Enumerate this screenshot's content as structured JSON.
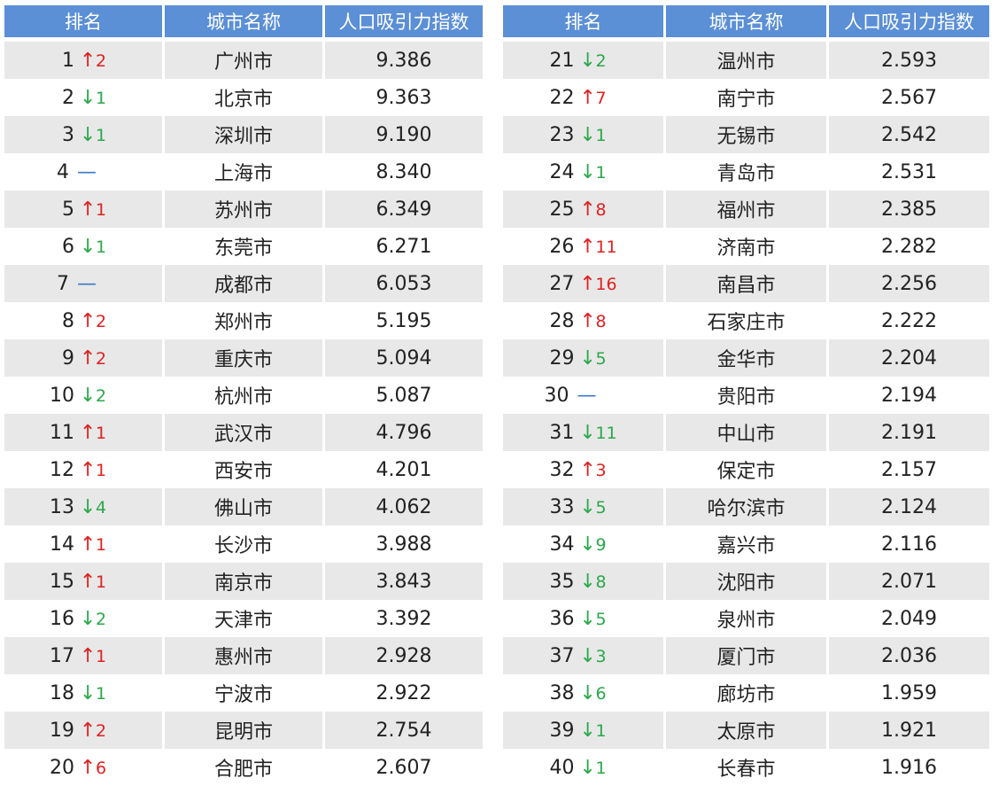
{
  "headers": {
    "rank": "排名",
    "city": "城市名称",
    "index": "人口吸引力指数"
  },
  "colors": {
    "header_bg": "#5b8fd6",
    "up": "#e02020",
    "down": "#2aa84a",
    "flat": "#3a78c9",
    "stripe": "#e8e8e8"
  },
  "rows": [
    {
      "rank": "1",
      "dir": "up",
      "change": "2",
      "city": "广州市",
      "index": "9.386"
    },
    {
      "rank": "2",
      "dir": "down",
      "change": "1",
      "city": "北京市",
      "index": "9.363"
    },
    {
      "rank": "3",
      "dir": "down",
      "change": "1",
      "city": "深圳市",
      "index": "9.190"
    },
    {
      "rank": "4",
      "dir": "flat",
      "change": "",
      "city": "上海市",
      "index": "8.340"
    },
    {
      "rank": "5",
      "dir": "up",
      "change": "1",
      "city": "苏州市",
      "index": "6.349"
    },
    {
      "rank": "6",
      "dir": "down",
      "change": "1",
      "city": "东莞市",
      "index": "6.271"
    },
    {
      "rank": "7",
      "dir": "flat",
      "change": "",
      "city": "成都市",
      "index": "6.053"
    },
    {
      "rank": "8",
      "dir": "up",
      "change": "2",
      "city": "郑州市",
      "index": "5.195"
    },
    {
      "rank": "9",
      "dir": "up",
      "change": "2",
      "city": "重庆市",
      "index": "5.094"
    },
    {
      "rank": "10",
      "dir": "down",
      "change": "2",
      "city": "杭州市",
      "index": "5.087"
    },
    {
      "rank": "11",
      "dir": "up",
      "change": "1",
      "city": "武汉市",
      "index": "4.796"
    },
    {
      "rank": "12",
      "dir": "up",
      "change": "1",
      "city": "西安市",
      "index": "4.201"
    },
    {
      "rank": "13",
      "dir": "down",
      "change": "4",
      "city": "佛山市",
      "index": "4.062"
    },
    {
      "rank": "14",
      "dir": "up",
      "change": "1",
      "city": "长沙市",
      "index": "3.988"
    },
    {
      "rank": "15",
      "dir": "up",
      "change": "1",
      "city": "南京市",
      "index": "3.843"
    },
    {
      "rank": "16",
      "dir": "down",
      "change": "2",
      "city": "天津市",
      "index": "3.392"
    },
    {
      "rank": "17",
      "dir": "up",
      "change": "1",
      "city": "惠州市",
      "index": "2.928"
    },
    {
      "rank": "18",
      "dir": "down",
      "change": "1",
      "city": "宁波市",
      "index": "2.922"
    },
    {
      "rank": "19",
      "dir": "up",
      "change": "2",
      "city": "昆明市",
      "index": "2.754"
    },
    {
      "rank": "20",
      "dir": "up",
      "change": "6",
      "city": "合肥市",
      "index": "2.607"
    },
    {
      "rank": "21",
      "dir": "down",
      "change": "2",
      "city": "温州市",
      "index": "2.593"
    },
    {
      "rank": "22",
      "dir": "up",
      "change": "7",
      "city": "南宁市",
      "index": "2.567"
    },
    {
      "rank": "23",
      "dir": "down",
      "change": "1",
      "city": "无锡市",
      "index": "2.542"
    },
    {
      "rank": "24",
      "dir": "down",
      "change": "1",
      "city": "青岛市",
      "index": "2.531"
    },
    {
      "rank": "25",
      "dir": "up",
      "change": "8",
      "city": "福州市",
      "index": "2.385"
    },
    {
      "rank": "26",
      "dir": "up",
      "change": "11",
      "city": "济南市",
      "index": "2.282"
    },
    {
      "rank": "27",
      "dir": "up",
      "change": "16",
      "city": "南昌市",
      "index": "2.256"
    },
    {
      "rank": "28",
      "dir": "up",
      "change": "8",
      "city": "石家庄市",
      "index": "2.222"
    },
    {
      "rank": "29",
      "dir": "down",
      "change": "5",
      "city": "金华市",
      "index": "2.204"
    },
    {
      "rank": "30",
      "dir": "flat",
      "change": "",
      "city": "贵阳市",
      "index": "2.194"
    },
    {
      "rank": "31",
      "dir": "down",
      "change": "11",
      "city": "中山市",
      "index": "2.191"
    },
    {
      "rank": "32",
      "dir": "up",
      "change": "3",
      "city": "保定市",
      "index": "2.157"
    },
    {
      "rank": "33",
      "dir": "down",
      "change": "5",
      "city": "哈尔滨市",
      "index": "2.124"
    },
    {
      "rank": "34",
      "dir": "down",
      "change": "9",
      "city": "嘉兴市",
      "index": "2.116"
    },
    {
      "rank": "35",
      "dir": "down",
      "change": "8",
      "city": "沈阳市",
      "index": "2.071"
    },
    {
      "rank": "36",
      "dir": "down",
      "change": "5",
      "city": "泉州市",
      "index": "2.049"
    },
    {
      "rank": "37",
      "dir": "down",
      "change": "3",
      "city": "厦门市",
      "index": "2.036"
    },
    {
      "rank": "38",
      "dir": "down",
      "change": "6",
      "city": "廊坊市",
      "index": "1.959"
    },
    {
      "rank": "39",
      "dir": "down",
      "change": "1",
      "city": "太原市",
      "index": "1.921"
    },
    {
      "rank": "40",
      "dir": "down",
      "change": "1",
      "city": "长春市",
      "index": "1.916"
    }
  ]
}
